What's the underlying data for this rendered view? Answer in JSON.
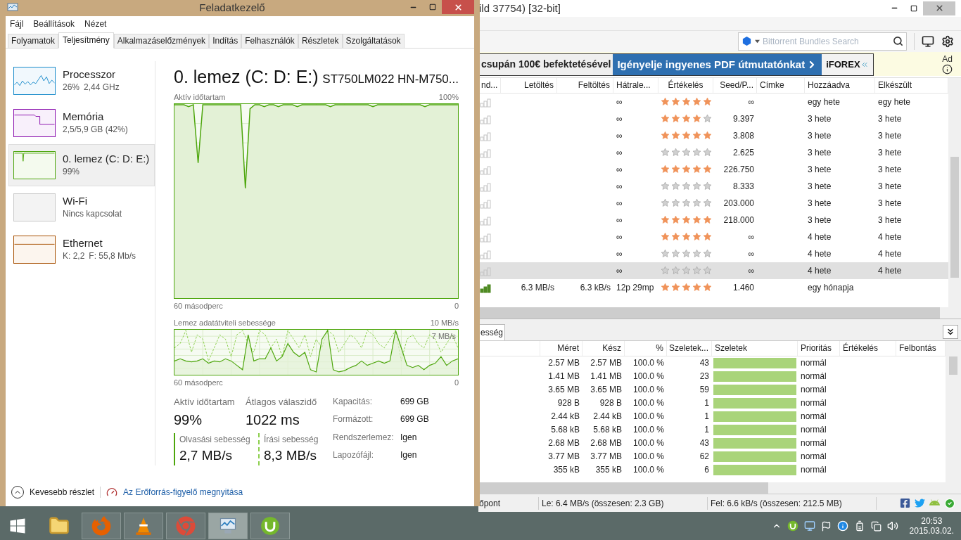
{
  "task_manager": {
    "title": "Feladatkezelő",
    "menu": [
      "Fájl",
      "Beállítások",
      "Nézet"
    ],
    "tabs": [
      {
        "label": "Folyamatok",
        "selected": false
      },
      {
        "label": "Teljesítmény",
        "selected": true
      },
      {
        "label": "Alkalmazáselőzmények",
        "selected": false
      },
      {
        "label": "Indítás",
        "selected": false
      },
      {
        "label": "Felhasználók",
        "selected": false
      },
      {
        "label": "Részletek",
        "selected": false
      },
      {
        "label": "Szolgáltatások",
        "selected": false
      }
    ],
    "resources": [
      {
        "kind": "cpu",
        "name": "Processzor",
        "detail": [
          "26%",
          "2,44 GHz"
        ],
        "selected": false
      },
      {
        "kind": "memory",
        "name": "Memória",
        "detail": [
          "2,5/5,9 GB (42%)"
        ],
        "selected": false
      },
      {
        "kind": "disk",
        "name": "0. lemez (C: D: E:)",
        "detail": [
          "99%"
        ],
        "selected": true
      },
      {
        "kind": "wifi",
        "name": "Wi-Fi",
        "detail": [
          "Nincs kapcsolat"
        ],
        "selected": false
      },
      {
        "kind": "ethernet",
        "name": "Ethernet",
        "detail": [
          "K: 2,2",
          "F: 55,8 Mb/s"
        ],
        "selected": false
      }
    ],
    "detail": {
      "title": "0. lemez (C: D: E:)",
      "model": "ST750LM022 HN-M750...",
      "active_chart": {
        "label": "Aktív időtartam",
        "max": "100%",
        "time_span": "60 másodperc",
        "min": "0"
      },
      "transfer_chart": {
        "label": "Lemez adatátviteli sebessége",
        "max": "10 MB/s",
        "marker": "7 MB/s",
        "time_span": "60 másodperc",
        "min": "0"
      },
      "stats": [
        {
          "label": "Aktív időtartam",
          "value": "99%"
        },
        {
          "label": "Átlagos válaszidő",
          "value": "1022 ms"
        }
      ],
      "speeds": [
        {
          "kind": "read",
          "label": "Olvasási sebesség",
          "value": "2,7 MB/s"
        },
        {
          "kind": "write",
          "label": "Írási sebesség",
          "value": "8,3 MB/s"
        }
      ],
      "properties": [
        {
          "label": "Kapacitás:",
          "value": "699 GB"
        },
        {
          "label": "Formázott:",
          "value": "699 GB"
        },
        {
          "label": "Rendszerlemez:",
          "value": "Igen"
        },
        {
          "label": "Lapozófájl:",
          "value": "Igen"
        }
      ]
    },
    "footer": {
      "less_details": "Kevesebb részlet",
      "resource_monitor_link": "Az Erőforrás-figyelő megnyitása"
    }
  },
  "utorrent": {
    "title": "ild 37754) [32-bit]",
    "search": {
      "placeholder": "Bittorrent Bundles Search"
    },
    "ad": {
      "headline": "csupán 100€ befektetésével",
      "cta": "Igényelje ingyenes PDF útmutatónkat",
      "brand": "iFOREX",
      "label": "Ad"
    },
    "columns": [
      "nd...",
      "Letöltés",
      "Feltöltés",
      "Hátrale...",
      "Értékelés",
      "Seed/P...",
      "Címke",
      "Hozzáadva",
      "Elkészült"
    ],
    "rows": [
      {
        "healthy": false,
        "remaining": "∞",
        "stars": 5,
        "seed_peer": "∞",
        "added": "egy hete",
        "completed": "egy hete",
        "selected": false
      },
      {
        "healthy": false,
        "remaining": "∞",
        "stars": 4,
        "seed_peer": "9.397",
        "added": "3 hete",
        "completed": "3 hete",
        "selected": false
      },
      {
        "healthy": false,
        "remaining": "∞",
        "stars": 5,
        "seed_peer": "3.808",
        "added": "3 hete",
        "completed": "3 hete",
        "selected": false
      },
      {
        "healthy": false,
        "remaining": "∞",
        "stars": 0,
        "seed_peer": "2.625",
        "added": "3 hete",
        "completed": "3 hete",
        "selected": false
      },
      {
        "healthy": false,
        "remaining": "∞",
        "stars": 5,
        "seed_peer": "226.750",
        "added": "3 hete",
        "completed": "3 hete",
        "selected": false
      },
      {
        "healthy": false,
        "remaining": "∞",
        "stars": 0,
        "seed_peer": "8.333",
        "added": "3 hete",
        "completed": "3 hete",
        "selected": false
      },
      {
        "healthy": false,
        "remaining": "∞",
        "stars": 0,
        "seed_peer": "203.000",
        "added": "3 hete",
        "completed": "3 hete",
        "selected": false
      },
      {
        "healthy": false,
        "remaining": "∞",
        "stars": 5,
        "seed_peer": "218.000",
        "added": "3 hete",
        "completed": "3 hete",
        "selected": false
      },
      {
        "healthy": false,
        "remaining": "∞",
        "stars": 5,
        "seed_peer": "∞",
        "added": "4 hete",
        "completed": "4 hete",
        "selected": false
      },
      {
        "healthy": false,
        "remaining": "∞",
        "stars": 0,
        "seed_peer": "∞",
        "added": "4 hete",
        "completed": "4 hete",
        "selected": false
      },
      {
        "healthy": false,
        "remaining": "∞",
        "stars": 0,
        "seed_peer": "∞",
        "added": "4 hete",
        "completed": "4 hete",
        "selected": true
      },
      {
        "healthy": true,
        "download": "6.3 MB/s",
        "upload": "6.3 kB/s",
        "remaining": "12p 29mp",
        "stars": 5,
        "seed_peer": "1.460",
        "added": "egy hónapja",
        "selected": false
      }
    ],
    "detail_tab": {
      "label": "esség",
      "selected": true
    },
    "file_columns": [
      "Méret",
      "Kész",
      "%",
      "Szeletek...",
      "Szeletek",
      "Prioritás",
      "Értékelés",
      "Felbontás"
    ],
    "files": [
      {
        "size": "2.57 MB",
        "done": "2.57 MB",
        "percent": "100.0 %",
        "pieces": "43",
        "level": 1,
        "priority": "normál"
      },
      {
        "size": "1.41 MB",
        "done": "1.41 MB",
        "percent": "100.0 %",
        "pieces": "23",
        "level": 1,
        "priority": "normál"
      },
      {
        "size": "3.65 MB",
        "done": "3.65 MB",
        "percent": "100.0 %",
        "pieces": "59",
        "level": 1,
        "priority": "normál"
      },
      {
        "size": "928 B",
        "done": "928 B",
        "percent": "100.0 %",
        "pieces": "1",
        "level": 1,
        "priority": "normál"
      },
      {
        "size": "2.44 kB",
        "done": "2.44 kB",
        "percent": "100.0 %",
        "pieces": "1",
        "level": 1,
        "priority": "normál"
      },
      {
        "size": "5.68 kB",
        "done": "5.68 kB",
        "percent": "100.0 %",
        "pieces": "1",
        "level": 1,
        "priority": "normál"
      },
      {
        "size": "2.68 MB",
        "done": "2.68 MB",
        "percent": "100.0 %",
        "pieces": "43",
        "level": 1,
        "priority": "normál"
      },
      {
        "size": "3.77 MB",
        "done": "3.77 MB",
        "percent": "100.0 %",
        "pieces": "62",
        "level": 1,
        "priority": "normál"
      },
      {
        "size": "355 kB",
        "done": "355 kB",
        "percent": "100.0 %",
        "pieces": "6",
        "level": 1,
        "priority": "normál"
      }
    ],
    "status": [
      "őpont",
      "Le: 6.4 MB/s (összesen: 2.3 GB)",
      "Fel: 6.6 kB/s (összesen: 212.5 MB)"
    ]
  },
  "taskbar": {
    "apps": [
      {
        "kind": "explorer",
        "running": false,
        "selected": false
      },
      {
        "kind": "firefox",
        "running": true,
        "selected": false
      },
      {
        "kind": "vlc",
        "running": true,
        "selected": false
      },
      {
        "kind": "chrome",
        "running": true,
        "selected": false
      },
      {
        "kind": "taskmanager",
        "running": true,
        "selected": true
      },
      {
        "kind": "utorrent",
        "running": true,
        "selected": false
      }
    ],
    "time": "20:53",
    "date": "2015.03.02."
  }
}
